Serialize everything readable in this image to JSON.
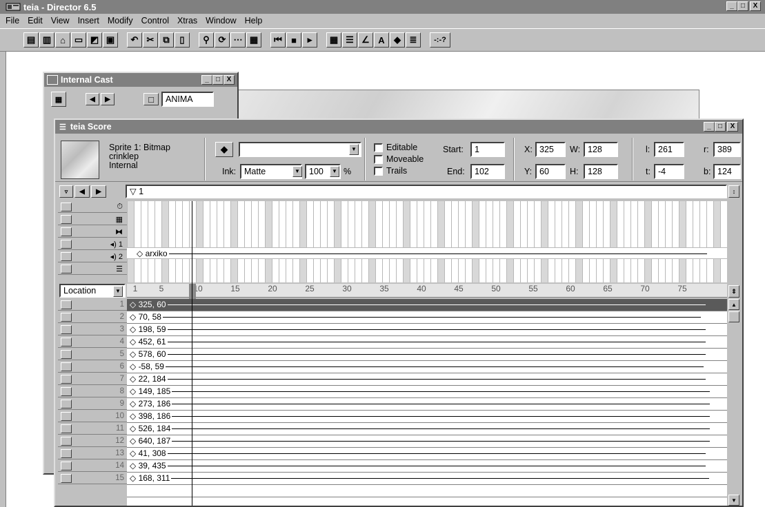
{
  "window": {
    "title": "teia - Director 6.5",
    "controls": [
      "_",
      "□",
      "X"
    ]
  },
  "menubar": [
    {
      "label": "File"
    },
    {
      "label": "Edit"
    },
    {
      "label": "View"
    },
    {
      "label": "Insert"
    },
    {
      "label": "Modify"
    },
    {
      "label": "Control"
    },
    {
      "label": "Xtras"
    },
    {
      "label": "Window"
    },
    {
      "label": "Help"
    }
  ],
  "toolbar": {
    "buttons": [
      "new-movie-icon",
      "new-cast-icon",
      "open-icon",
      "save-icon",
      "save-all-icon",
      "import-icon",
      "undo-icon",
      "cut-icon",
      "copy-icon",
      "paste-icon",
      "find-icon",
      "exchange-icon",
      "text-icon",
      "bitmap-icon",
      "rewind-icon",
      "stop-icon",
      "play-icon",
      "cast-icon",
      "score-icon",
      "paint-icon",
      "text-window-icon",
      "behavior-icon",
      "script-icon",
      "help-icon"
    ],
    "help_label": "-:-?"
  },
  "cast_window": {
    "title": "Internal Cast",
    "member_name": "ANIMA"
  },
  "score_window": {
    "title": "teia Score",
    "sprite": {
      "label_line1": "Sprite 1: Bitmap",
      "label_line2": "crinklep",
      "label_line3": "Internal",
      "ink_label": "Ink:",
      "ink_value": "Matte",
      "blend_value": "100",
      "blend_unit": "%",
      "editable_label": "Editable",
      "moveable_label": "Moveable",
      "trails_label": "Trails",
      "start_label": "Start:",
      "start_value": "1",
      "end_label": "End:",
      "end_value": "102",
      "x_label": "X:",
      "x_value": "325",
      "y_label": "Y:",
      "y_value": "60",
      "w_label": "W:",
      "w_value": "128",
      "h_label": "H:",
      "h_value": "128",
      "l_label": "l:",
      "l_value": "261",
      "t_label": "t:",
      "t_value": "-4",
      "r_label": "r:",
      "r_value": "389",
      "b_label": "b:",
      "b_value": "124"
    },
    "marker_label": "1",
    "sound_cell": "arxiko",
    "channels": [
      {
        "icon": "tempo-icon",
        "label": "⏱"
      },
      {
        "icon": "palette-icon",
        "label": "▦"
      },
      {
        "icon": "transition-icon",
        "label": "⧓"
      },
      {
        "icon": "sound-1-icon",
        "label": "◂) 1"
      },
      {
        "icon": "sound-2-icon",
        "label": "◂) 2"
      },
      {
        "icon": "script-channel-icon",
        "label": "☰"
      }
    ],
    "display_mode": "Location",
    "frame_ruler": [
      "1",
      "5",
      "10",
      "15",
      "20",
      "25",
      "30",
      "35",
      "40",
      "45",
      "50",
      "55",
      "60",
      "65",
      "70",
      "75"
    ],
    "sprite_rows": [
      {
        "num": "1",
        "value": "325, 60"
      },
      {
        "num": "2",
        "value": "70, 58"
      },
      {
        "num": "3",
        "value": "198, 59"
      },
      {
        "num": "4",
        "value": "452, 61"
      },
      {
        "num": "5",
        "value": "578, 60"
      },
      {
        "num": "6",
        "value": "-58, 59"
      },
      {
        "num": "7",
        "value": "22, 184"
      },
      {
        "num": "8",
        "value": "149, 185"
      },
      {
        "num": "9",
        "value": "273, 186"
      },
      {
        "num": "10",
        "value": "398, 186"
      },
      {
        "num": "11",
        "value": "526, 184"
      },
      {
        "num": "12",
        "value": "640, 187"
      },
      {
        "num": "13",
        "value": "41, 308"
      },
      {
        "num": "14",
        "value": "39, 435"
      },
      {
        "num": "15",
        "value": "168, 311"
      }
    ]
  }
}
